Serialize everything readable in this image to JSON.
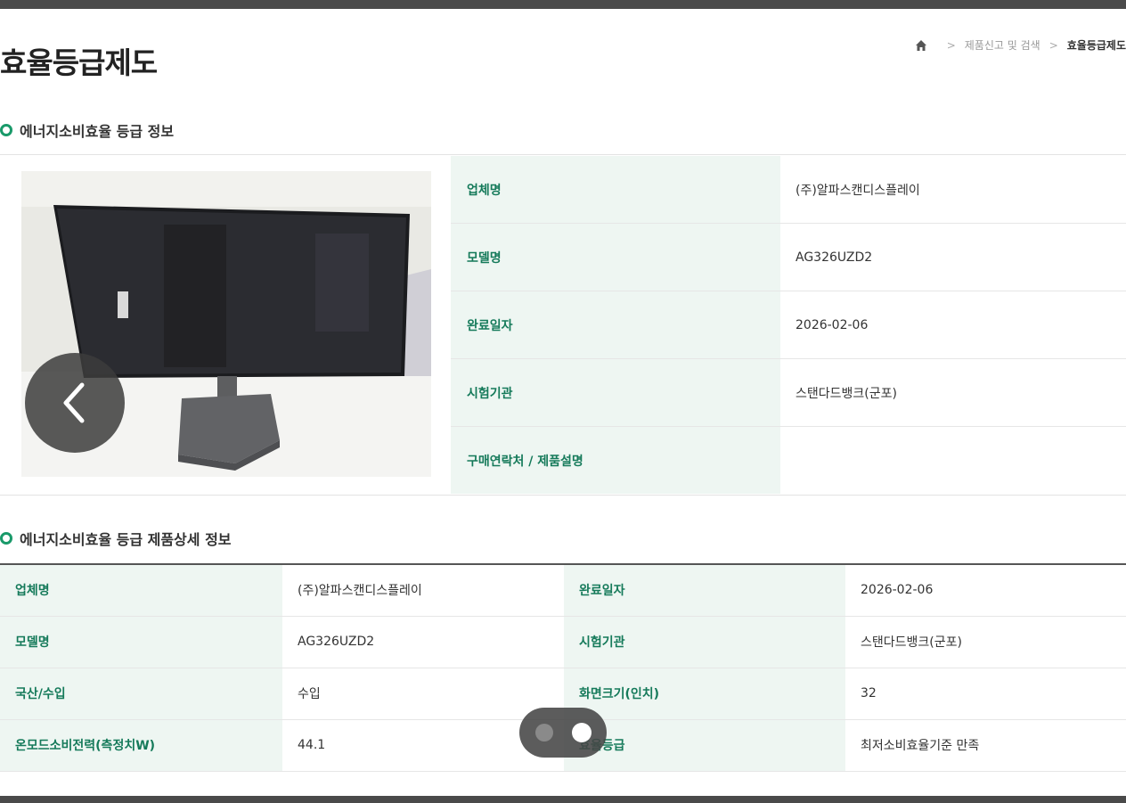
{
  "page": {
    "title": "효율등급제도"
  },
  "breadcrumb": {
    "home_icon": "home-icon",
    "items": [
      "제품신고 및 검색",
      "효율등급제도"
    ]
  },
  "sections": {
    "info_title": "에너지소비효율 등급 정보",
    "detail_title": "에너지소비효율 등급 제품상세 정보"
  },
  "info": {
    "rows": [
      {
        "label": "업체명",
        "value": "(주)알파스캔디스플레이"
      },
      {
        "label": "모델명",
        "value": "AG326UZD2"
      },
      {
        "label": "완료일자",
        "value": "2026-02-06"
      },
      {
        "label": "시험기관",
        "value": "스탠다드뱅크(군포)"
      },
      {
        "label": "구매연락처 / 제품설명",
        "value": ""
      }
    ]
  },
  "detail": {
    "rows": [
      {
        "l1": "업체명",
        "v1": "(주)알파스캔디스플레이",
        "l2": "완료일자",
        "v2": "2026-02-06"
      },
      {
        "l1": "모델명",
        "v1": "AG326UZD2",
        "l2": "시험기관",
        "v2": "스탠다드뱅크(군포)"
      },
      {
        "l1": "국산/수입",
        "v1": "수입",
        "l2": "화면크기(인치)",
        "v2": "32"
      },
      {
        "l1": "온모드소비전력(측정치W)",
        "v1": "44.1",
        "l2": "효율등급",
        "v2": "최저소비효율기준 만족"
      }
    ]
  },
  "overlay": {
    "prev_icon": "chevron-left-icon",
    "pager_total": 2,
    "pager_current": 2
  },
  "colors": {
    "accent": "#1a9a6a",
    "label_text": "#157a5a",
    "label_bg": "#eef6f2"
  }
}
